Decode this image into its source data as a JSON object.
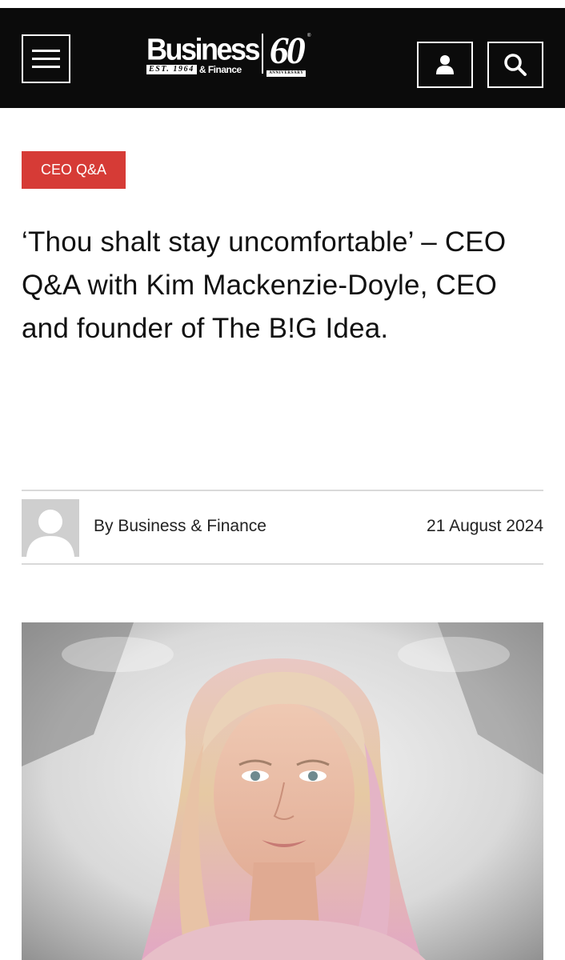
{
  "header": {
    "logo": {
      "name": "Business",
      "est": "EST. 1964",
      "finance": "& Finance",
      "anniversary_number": "60",
      "anniversary_label": "ANNIVERSARY",
      "registered": "®"
    },
    "menu_icon": "hamburger-menu-icon",
    "user_icon": "user-icon",
    "search_icon": "search-icon",
    "background_color": "#0b0b0b"
  },
  "article": {
    "category": "CEO Q&A",
    "category_color": "#d63b36",
    "headline": "‘Thou shalt stay uncomfortable’ – CEO Q&A with Kim Mackenzie-Doyle, CEO and founder of The B!G Idea.",
    "byline": "By Business & Finance",
    "date": "21 August 2024"
  }
}
